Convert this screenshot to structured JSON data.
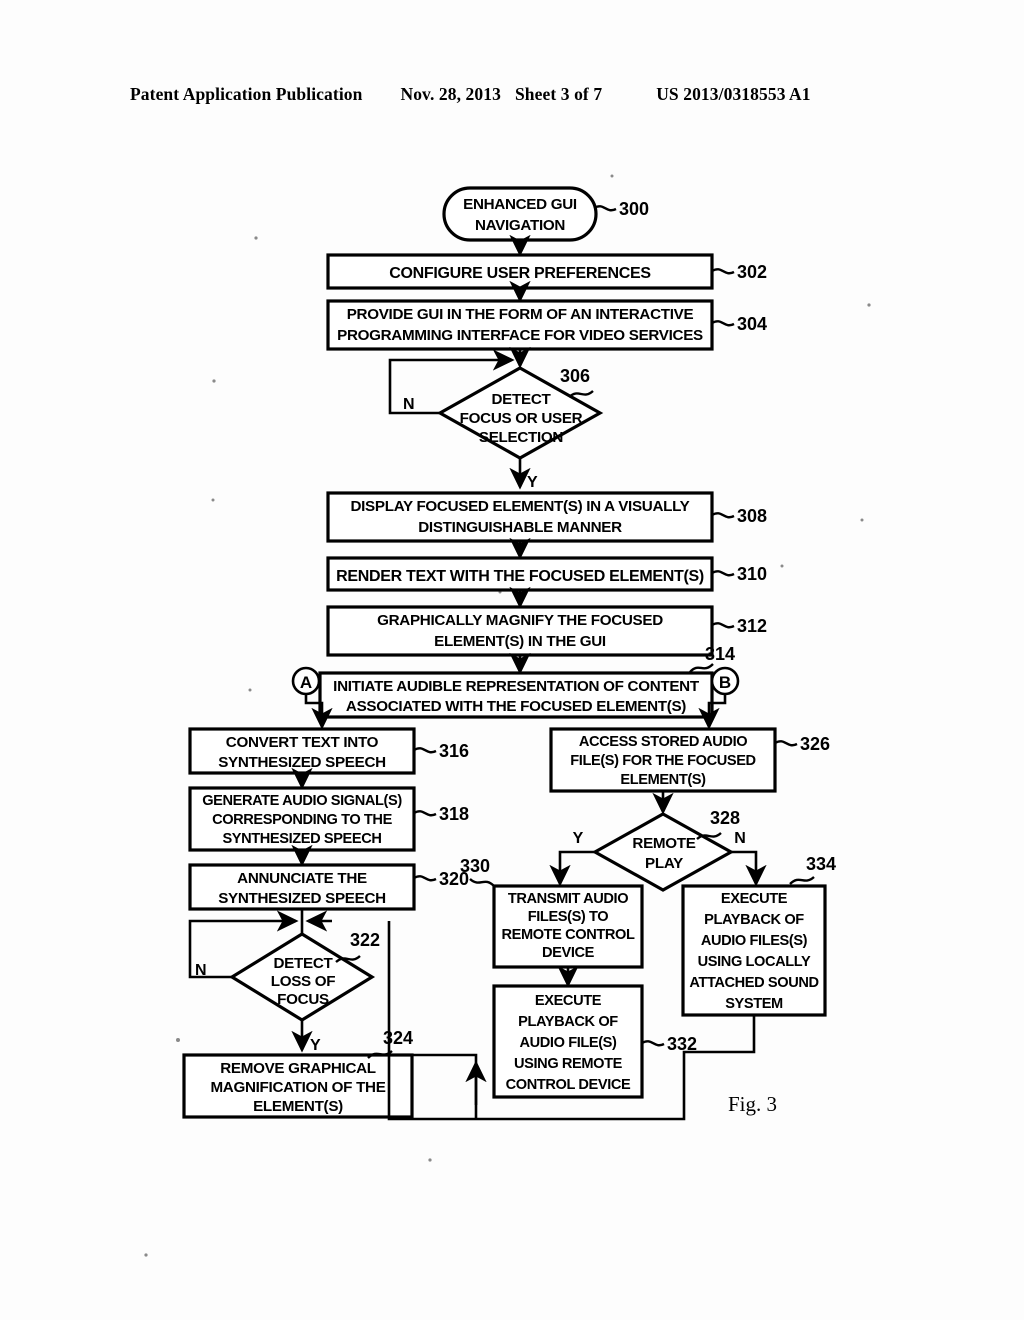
{
  "header": {
    "publication": "Patent Application Publication",
    "date": "Nov. 28, 2013",
    "sheet": "Sheet 3 of 7",
    "patent_number": "US 2013/0318553 A1"
  },
  "figure": {
    "label": "Fig. 3",
    "type": "flowchart",
    "connectors": {
      "a": "A",
      "b": "B"
    },
    "branch_labels": {
      "yes": "Y",
      "no": "N"
    },
    "nodes": [
      {
        "ref": "300",
        "shape": "terminator",
        "lines": [
          "ENHANCED GUI",
          "NAVIGATION"
        ]
      },
      {
        "ref": "302",
        "shape": "process",
        "lines": [
          "CONFIGURE USER PREFERENCES"
        ]
      },
      {
        "ref": "304",
        "shape": "process",
        "lines": [
          "PROVIDE GUI IN THE FORM OF AN INTERACTIVE",
          "PROGRAMMING INTERFACE FOR VIDEO SERVICES"
        ]
      },
      {
        "ref": "306",
        "shape": "decision",
        "lines": [
          "DETECT",
          "FOCUS OR USER",
          "SELECTION"
        ]
      },
      {
        "ref": "308",
        "shape": "process",
        "lines": [
          "DISPLAY FOCUSED ELEMENT(S) IN A VISUALLY",
          "DISTINGUISHABLE MANNER"
        ]
      },
      {
        "ref": "310",
        "shape": "process",
        "lines": [
          "RENDER TEXT WITH THE FOCUSED ELEMENT(S)"
        ]
      },
      {
        "ref": "312",
        "shape": "process",
        "lines": [
          "GRAPHICALLY MAGNIFY THE FOCUSED",
          "ELEMENT(S) IN THE GUI"
        ]
      },
      {
        "ref": "314",
        "shape": "process",
        "lines": [
          "INITIATE AUDIBLE REPRESENTATION OF CONTENT",
          "ASSOCIATED WITH THE FOCUSED ELEMENT(S)"
        ]
      },
      {
        "ref": "316",
        "shape": "process",
        "lines": [
          "CONVERT TEXT INTO",
          "SYNTHESIZED SPEECH"
        ]
      },
      {
        "ref": "318",
        "shape": "process",
        "lines": [
          "GENERATE AUDIO SIGNAL(S)",
          "CORRESPONDING TO THE",
          "SYNTHESIZED SPEECH"
        ]
      },
      {
        "ref": "320",
        "shape": "process",
        "lines": [
          "ANNUNCIATE THE",
          "SYNTHESIZED SPEECH"
        ]
      },
      {
        "ref": "322",
        "shape": "decision",
        "lines": [
          "DETECT",
          "LOSS OF",
          "FOCUS"
        ]
      },
      {
        "ref": "324",
        "shape": "process",
        "lines": [
          "REMOVE GRAPHICAL",
          "MAGNIFICATION OF THE",
          "ELEMENT(S)"
        ]
      },
      {
        "ref": "326",
        "shape": "process",
        "lines": [
          "ACCESS STORED AUDIO",
          "FILE(S) FOR THE FOCUSED",
          "ELEMENT(S)"
        ]
      },
      {
        "ref": "328",
        "shape": "decision",
        "lines": [
          "REMOTE",
          "PLAY"
        ]
      },
      {
        "ref": "330",
        "shape": "process",
        "lines": [
          "TRANSMIT AUDIO",
          "FILES(S) TO",
          "REMOTE CONTROL",
          "DEVICE"
        ]
      },
      {
        "ref": "332",
        "shape": "process",
        "lines": [
          "EXECUTE",
          "PLAYBACK OF",
          "AUDIO FILE(S)",
          "USING REMOTE",
          "CONTROL DEVICE"
        ]
      },
      {
        "ref": "334",
        "shape": "process",
        "lines": [
          "EXECUTE",
          "PLAYBACK OF",
          "AUDIO FILES(S)",
          "USING LOCALLY",
          "ATTACHED SOUND",
          "SYSTEM"
        ]
      }
    ]
  }
}
